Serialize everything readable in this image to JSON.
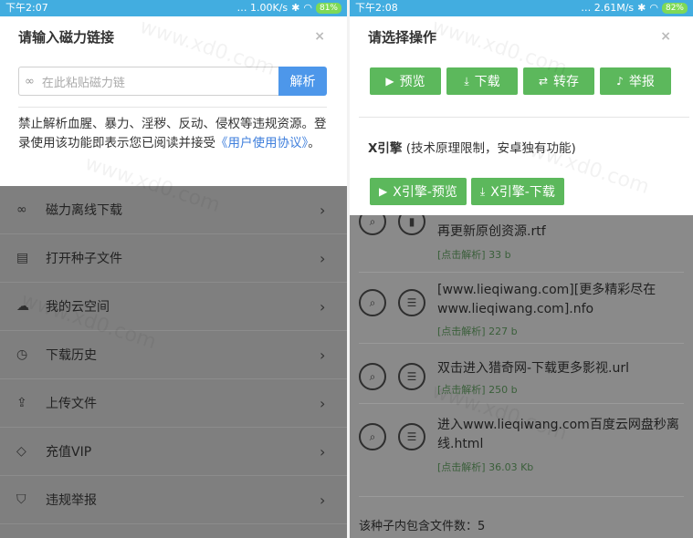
{
  "left": {
    "status": {
      "time": "下午2:07",
      "speed": "… 1.00K/s",
      "battery": "81%"
    },
    "dialog": {
      "title": "请输入磁力链接",
      "close": "×",
      "input_placeholder": "在此粘贴磁力链",
      "parse_label": "解析",
      "disclaimer_text": "禁止解析血腥、暴力、淫秽、反动、侵权等违规资源。登录使用该功能即表示您已阅读并接受",
      "disclaimer_link": "《用户使用协议》",
      "disclaimer_end": "。"
    },
    "menu": [
      {
        "icon": "magnet-icon",
        "label": "磁力离线下载"
      },
      {
        "icon": "file-icon",
        "label": "打开种子文件"
      },
      {
        "icon": "cloud-icon",
        "label": "我的云空间"
      },
      {
        "icon": "clock-icon",
        "label": "下载历史"
      },
      {
        "icon": "upload-icon",
        "label": "上传文件"
      },
      {
        "icon": "diamond-icon",
        "label": "充值VIP"
      },
      {
        "icon": "shield-icon",
        "label": "违规举报"
      }
    ]
  },
  "right": {
    "status": {
      "time": "下午2:08",
      "speed": "… 2.61M/s",
      "battery": "82%"
    },
    "dialog": {
      "title": "请选择操作",
      "close": "×",
      "buttons": [
        {
          "icon": "play-icon",
          "label": "预览"
        },
        {
          "icon": "download-icon",
          "label": "下载"
        },
        {
          "icon": "transfer-icon",
          "label": "转存"
        },
        {
          "icon": "bell-icon",
          "label": "举报"
        }
      ],
      "x_title_bold": "X引擎",
      "x_title_rest": " (技术原理限制，安卓独有功能)",
      "x_buttons": [
        {
          "icon": "play-icon",
          "label": "X引擎-预览"
        },
        {
          "icon": "download-icon",
          "label": "X引擎-下载"
        }
      ]
    },
    "files": [
      {
        "name": "再更新原创资源.rtf",
        "size": "[点击解析] 33 b"
      },
      {
        "name": "[www.lieqiwang.com][更多精彩尽在www.lieqiwang.com].nfo",
        "size": "[点击解析] 227 b"
      },
      {
        "name": "双击进入猎奇网-下载更多影视.url",
        "size": "[点击解析] 250 b"
      },
      {
        "name": "进入www.lieqiwang.com百度云网盘秒离线.html",
        "size": "[点击解析] 36.03 Kb"
      }
    ],
    "file_count": "该种子内包含文件数：5"
  },
  "watermark": "www.xd0.com"
}
